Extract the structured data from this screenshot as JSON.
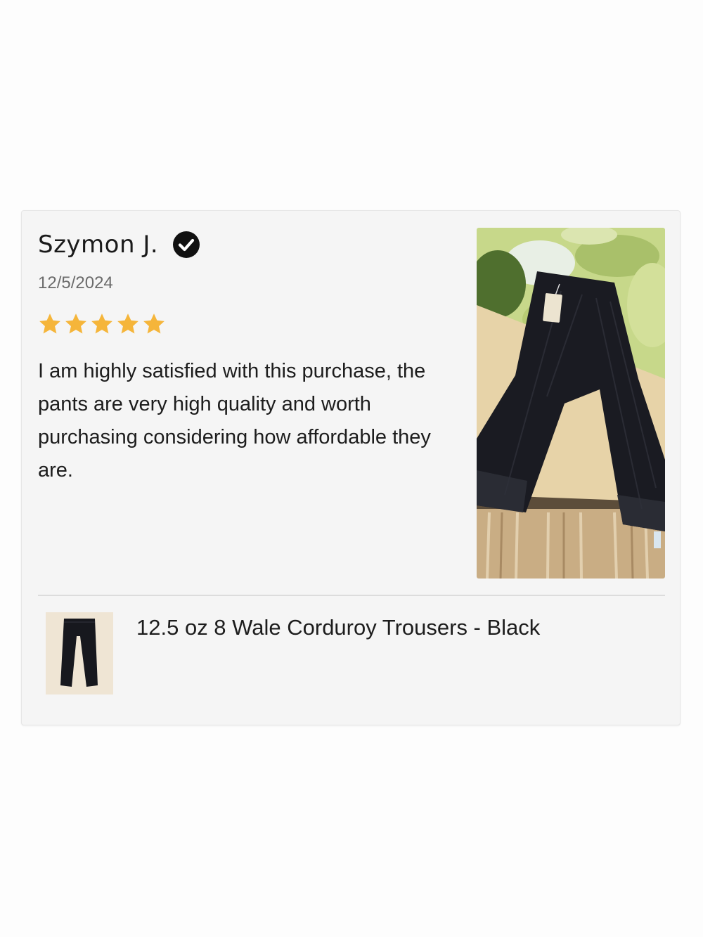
{
  "review": {
    "reviewer_name": "Szymon J.",
    "verified_icon": "verified-check-icon",
    "date": "12/5/2024",
    "rating": 5,
    "rating_max": 5,
    "star_color": "#f5b53a",
    "body": "I am highly satisfied with this purchase, the pants are very high quality and worth purchasing considering how affordable they are."
  },
  "product": {
    "title": "12.5 oz 8 Wale Corduroy Trousers - Black"
  }
}
